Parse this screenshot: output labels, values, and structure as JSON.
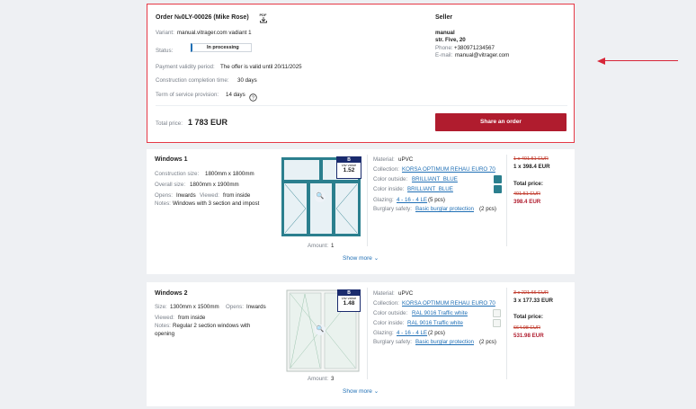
{
  "order": {
    "title": "Order №0LY-00026 (Mike Rose)",
    "pdf_icon": "pdf-download-icon",
    "variant_label": "Variant:",
    "variant_value": "manual.vitrager.com vadiant 1",
    "status_label": "Status:",
    "status_value": "In processing",
    "payment_label": "Payment validity period:",
    "payment_value": "The offer is valid until 20/11/2025",
    "construction_label": "Construction completion time:",
    "construction_value": "30 days",
    "service_label": "Term of service provision:",
    "service_value": "14 days",
    "total_label": "Total price:",
    "total_value": "1 783 EUR",
    "share_button": "Share an order",
    "accent_color": "#b01c2e"
  },
  "seller": {
    "heading": "Seller",
    "name": "manual",
    "address": "str. Five, 20",
    "phone_label": "Phone:",
    "phone": "+380971234567",
    "email_label": "E-mail:",
    "email": "manual@vitrager.com"
  },
  "items": [
    {
      "name": "Windows 1",
      "construction_size_label": "Construction size:",
      "construction_size": "1800mm x 1800mm",
      "overall_size_label": "Overall size:",
      "overall_size": "1800mm x 1900mm",
      "opens_label": "Opens:",
      "opens": "Inwards",
      "viewed_label": "Viewed:",
      "viewed": "from inside",
      "notes_label": "Notes:",
      "notes": "Windows with 3 section and impost",
      "uw_class": "B",
      "uw_label": "Uw value",
      "uw_value": "1.52",
      "amount_label": "Amount:",
      "amount": "1",
      "material_label": "Material:",
      "material": "uPVC",
      "collection_label": "Collection:",
      "collection": "KORSA OPTIMUM REHAU EURO 70",
      "color_outside_label": "Color outside:",
      "color_outside": "BRILLIANT_BLUE",
      "color_inside_label": "Color inside:",
      "color_inside": "BRILLIANT_BLUE",
      "swatch_color": "#2b7f8e",
      "glazing_label": "Glazing:",
      "glazing": "4 - 16 - 4 LE",
      "glazing_count": "(5 pcs)",
      "burglary_label": "Burglary safety:",
      "burglary": "Basic burglar protection",
      "burglary_count": "(2 pcs)",
      "unit_old": "1 x 401.51 EUR",
      "unit_new": "1 x 398.4 EUR",
      "total_label": "Total price:",
      "total_old": "401.51 EUR",
      "total_new": "398.4 EUR",
      "show_more": "Show more"
    },
    {
      "name": "Windows 2",
      "size_label": "Size:",
      "size": "1300mm x 1500mm",
      "opens_label": "Opens:",
      "opens": "Inwards",
      "viewed_label": "Viewed:",
      "viewed": "from inside",
      "notes_label": "Notes:",
      "notes_line1": "Regular 2 section windows with",
      "notes_line2": "opening",
      "uw_class": "B",
      "uw_label": "Uw value",
      "uw_value": "1.48",
      "amount_label": "Amount:",
      "amount": "3",
      "material_label": "Material:",
      "material": "uPVC",
      "collection_label": "Collection:",
      "collection": "KORSA OPTIMUM REHAU EURO 70",
      "color_outside_label": "Color outside:",
      "color_outside": "RAL 9016 Traffic white",
      "color_inside_label": "Color inside:",
      "color_inside": "RAL 9016 Traffic white",
      "swatch_color": "#f4f6f4",
      "glazing_label": "Glazing:",
      "glazing": "4 - 16 - 4 LE",
      "glazing_count": "(2 pcs)",
      "burglary_label": "Burglary safety:",
      "burglary": "Basic burglar protection",
      "burglary_count": "(2 pcs)",
      "unit_old": "3 x 221.66 EUR",
      "unit_new": "3 x 177.33 EUR",
      "total_label": "Total price:",
      "total_old": "664.98 EUR",
      "total_new": "531.98 EUR",
      "show_more": "Show more"
    }
  ]
}
